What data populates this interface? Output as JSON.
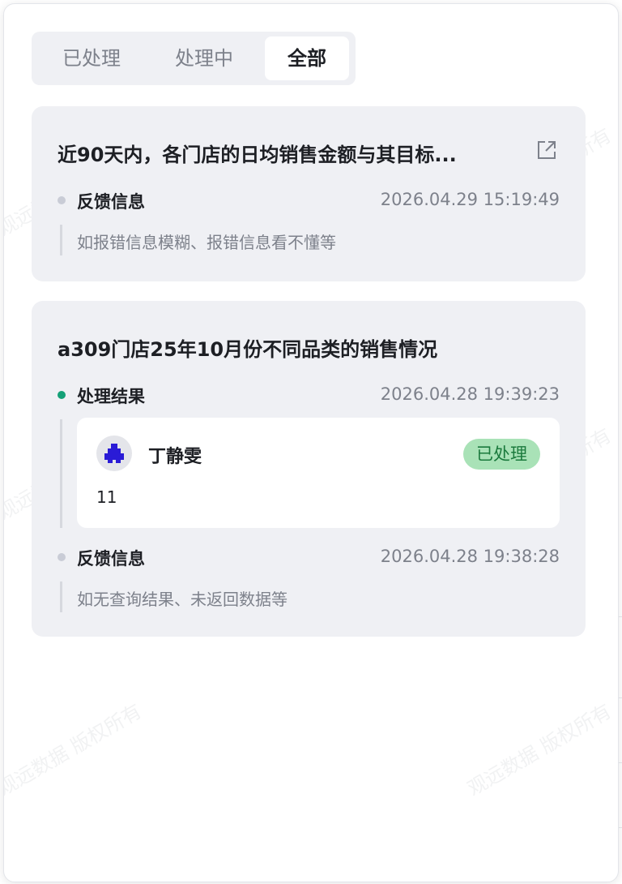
{
  "tabs": [
    {
      "label": "已处理",
      "active": false
    },
    {
      "label": "处理中",
      "active": false
    },
    {
      "label": "全部",
      "active": true
    }
  ],
  "watermark": "观远数据 版权所有",
  "cards": [
    {
      "title": "近90天内，各门店的日均销售金额与其目标...",
      "feedback": {
        "label": "反馈信息",
        "time": "2026.04.29 15:19:49",
        "text": "如报错信息模糊、报错信息看不懂等"
      }
    },
    {
      "title": "a309门店25年10月份不同品类的销售情况",
      "result": {
        "label": "处理结果",
        "time": "2026.04.28 19:39:23",
        "user": "丁静雯",
        "status": "已处理",
        "reply": "11"
      },
      "feedback": {
        "label": "反馈信息",
        "time": "2026.04.28 19:38:28",
        "text": "如无查询结果、未返回数据等"
      }
    }
  ],
  "colors": {
    "accent_green": "#14a077",
    "badge_bg": "#a9e2b7",
    "badge_text": "#1b7a3d",
    "card_bg": "#eff0f4"
  },
  "icons": {
    "open": "external-link-icon",
    "avatar": "avatar"
  }
}
